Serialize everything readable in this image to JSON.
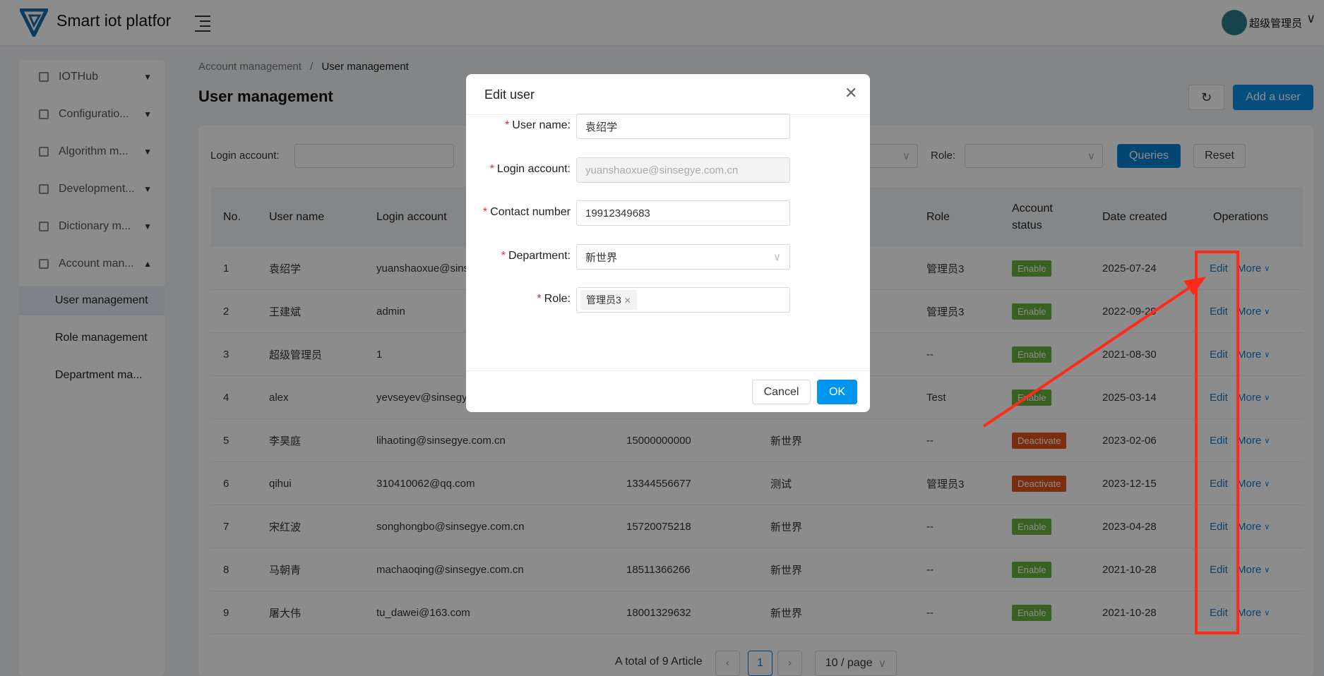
{
  "header": {
    "app_title": "Smart iot platfor",
    "user_name": "超级管理员"
  },
  "sidebar": {
    "items": [
      {
        "label": "IOTHub",
        "expanded": false
      },
      {
        "label": "Configuratio...",
        "expanded": false
      },
      {
        "label": "Algorithm m...",
        "expanded": false
      },
      {
        "label": "Development...",
        "expanded": false
      },
      {
        "label": "Dictionary m...",
        "expanded": false
      },
      {
        "label": "Account man...",
        "expanded": true
      }
    ],
    "sub_items": [
      {
        "label": "User management",
        "active": true
      },
      {
        "label": "Role management"
      },
      {
        "label": "Department ma..."
      }
    ]
  },
  "breadcrumb": {
    "parent": "Account management",
    "sep": "/",
    "current": "User management"
  },
  "page": {
    "title": "User management",
    "add_user": "Add a user"
  },
  "filters": {
    "login_account_label": "Login account:",
    "role_label": "Role:",
    "queries": "Queries",
    "reset": "Reset"
  },
  "table": {
    "headers": {
      "no": "No.",
      "user_name": "User name",
      "login_account": "Login account",
      "role": "Role",
      "account_status": "Account status",
      "date_created": "Date created",
      "operations": "Operations"
    },
    "rows": [
      {
        "no": "1",
        "name": "袁绍学",
        "login": "yuanshaoxue@sinsegye.com.cn",
        "phone": "",
        "dept": "",
        "role": "管理员3",
        "status": "Enable",
        "date": "2025-07-24"
      },
      {
        "no": "2",
        "name": "王建斌",
        "login": "admin",
        "phone": "",
        "dept": "",
        "role": "管理员3",
        "status": "Enable",
        "date": "2022-09-29"
      },
      {
        "no": "3",
        "name": "超级管理员",
        "login": "1",
        "phone": "",
        "dept": "",
        "role": "--",
        "status": "Enable",
        "date": "2021-08-30"
      },
      {
        "no": "4",
        "name": "alex",
        "login": "yevseyev@sinsegye.com.cn",
        "phone": "",
        "dept": "",
        "role": "Test",
        "status": "Enable",
        "date": "2025-03-14"
      },
      {
        "no": "5",
        "name": "李昊庭",
        "login": "lihaoting@sinsegye.com.cn",
        "phone": "15000000000",
        "dept": "新世界",
        "role": "--",
        "status": "Deactivate",
        "date": "2023-02-06"
      },
      {
        "no": "6",
        "name": "qihui",
        "login": "310410062@qq.com",
        "phone": "13344556677",
        "dept": "测试",
        "role": "管理员3",
        "status": "Deactivate",
        "date": "2023-12-15"
      },
      {
        "no": "7",
        "name": "宋红波",
        "login": "songhongbo@sinsegye.com.cn",
        "phone": "15720075218",
        "dept": "新世界",
        "role": "--",
        "status": "Enable",
        "date": "2023-04-28"
      },
      {
        "no": "8",
        "name": "马朝青",
        "login": "machaoqing@sinsegye.com.cn",
        "phone": "18511366266",
        "dept": "新世界",
        "role": "--",
        "status": "Enable",
        "date": "2021-10-28"
      },
      {
        "no": "9",
        "name": "屠大伟",
        "login": "tu_dawei@163.com",
        "phone": "18001329632",
        "dept": "新世界",
        "role": "--",
        "status": "Enable",
        "date": "2021-10-28"
      }
    ],
    "edit_label": "Edit",
    "more_label": "More"
  },
  "pagination": {
    "total_text": "A total of 9 Article",
    "current_page": "1",
    "page_size": "10 / page"
  },
  "colors": {
    "enable": "#67b13f",
    "deactivate": "#e0541a",
    "primary": "#0a8ee6",
    "annotation": "#ff2a1a"
  },
  "dialog": {
    "title": "Edit user",
    "fields": [
      {
        "label": "User name:",
        "value": "袁绍学"
      },
      {
        "label": "Login account:",
        "value": "yuanshaoxue@sinsegye.com.cn",
        "disabled": true
      },
      {
        "label": "Contact number",
        "value": "19912349683"
      },
      {
        "label": "Department:",
        "value": "新世界"
      },
      {
        "label": "Role:",
        "tag": "管理员3"
      }
    ],
    "cancel": "Cancel",
    "ok": "OK"
  }
}
